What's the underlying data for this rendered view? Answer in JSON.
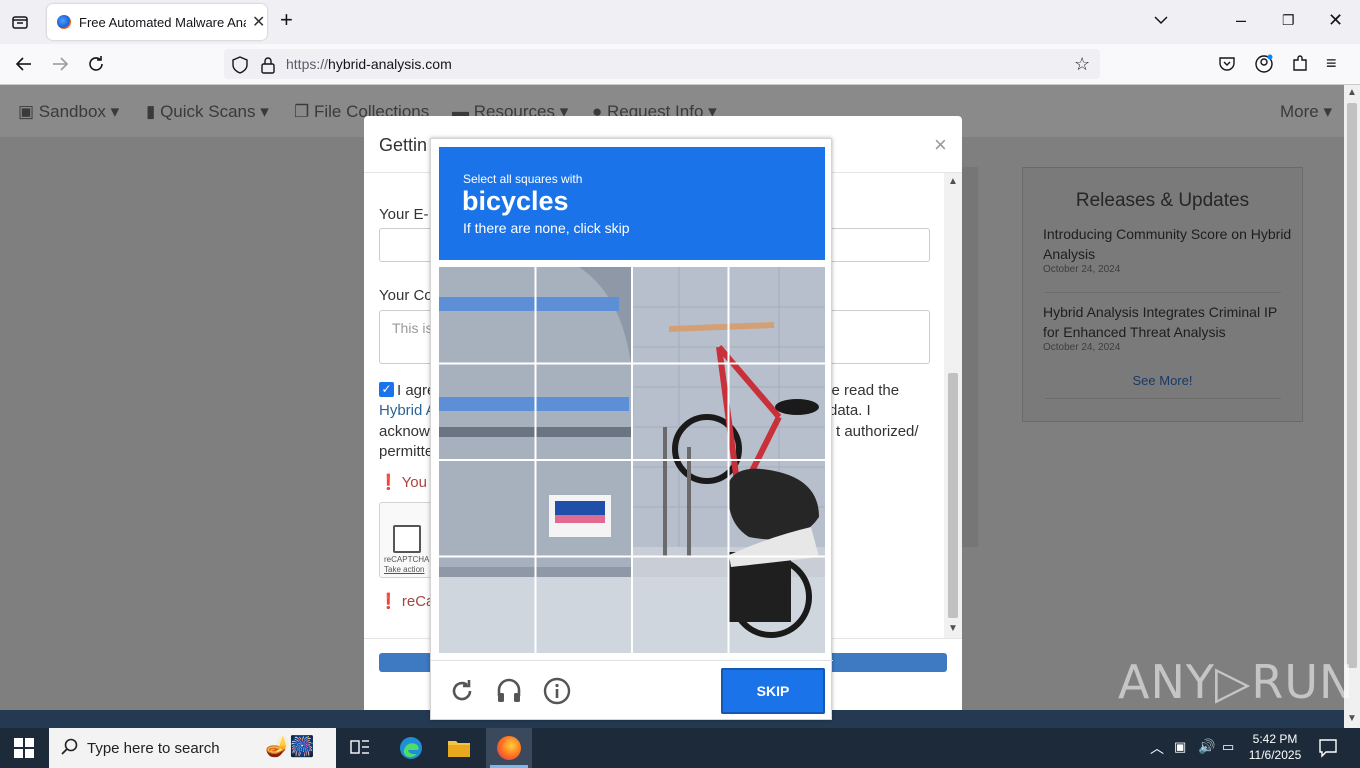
{
  "browser": {
    "tab_title": "Free Automated Malware Analy",
    "url_prefix": "https://",
    "url_host": "hybrid-analysis.com"
  },
  "site_nav": {
    "items": [
      "Sandbox ▾",
      "Quick Scans ▾",
      "File Collections",
      "Resources ▾",
      "Request Info ▾"
    ],
    "more": "More ▾"
  },
  "releases": {
    "title": "Releases & Updates",
    "items": [
      {
        "title": "Introducing Community Score on Hybrid Analysis",
        "date": "October 24, 2024"
      },
      {
        "title": "Hybrid Analysis Integrates Criminal IP for Enhanced Threat Analysis",
        "date": "October 24, 2024"
      }
    ],
    "see_more": "See More!"
  },
  "modal": {
    "title": "Gettin",
    "close": "×",
    "email_label": "Your E-",
    "comment_label": "Your Co",
    "comment_placeholder": "This is",
    "agree_left": [
      "I agre",
      "Hybrid A",
      "acknow",
      "permitte"
    ],
    "agree_right": [
      "ve read the",
      "data. I",
      "t authorized/"
    ],
    "error1": "You r",
    "recaptcha_label": "reCAPTCHA",
    "recaptcha_action": "Take action",
    "error2": "reCap"
  },
  "captcha": {
    "line1": "Select all squares with",
    "keyword": "bicycles",
    "line3": "If there are none, click skip",
    "skip": "SKIP"
  },
  "taskbar": {
    "search_placeholder": "Type here to search",
    "time": "5:42 PM",
    "date": "11/6/2025"
  },
  "watermark": "ANY▷RUN"
}
